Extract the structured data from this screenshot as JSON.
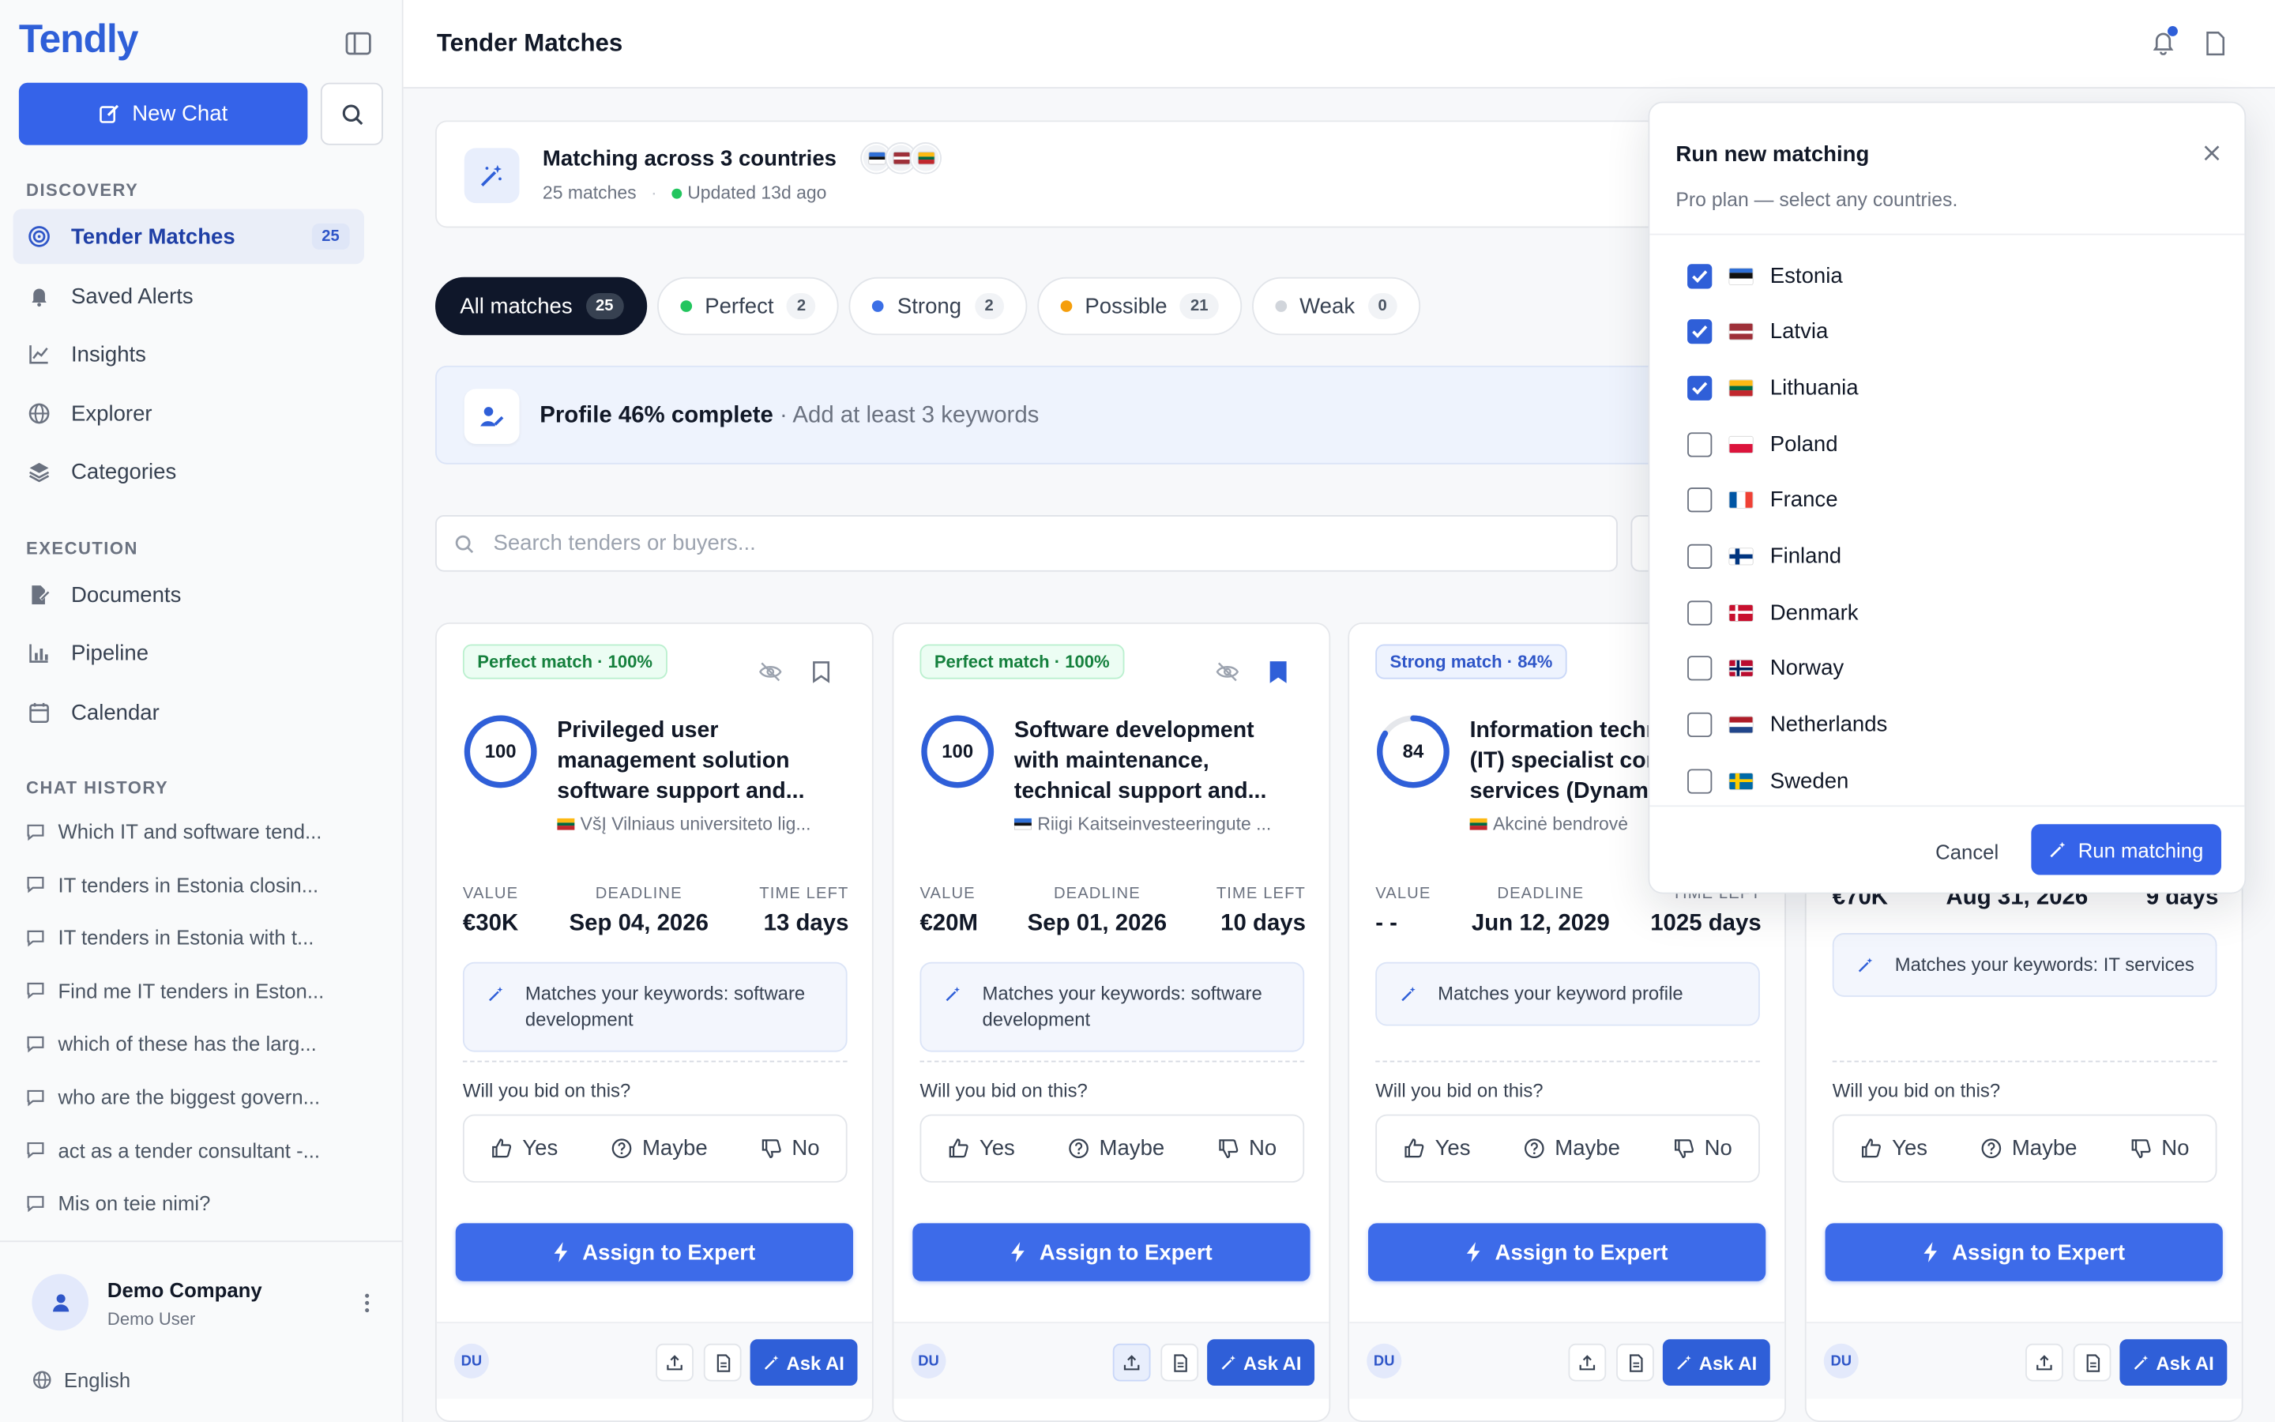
{
  "sidebar": {
    "logo": "Tendly",
    "new_chat": "New Chat",
    "discovery_title": "DISCOVERY",
    "discovery": [
      {
        "label": "Tender Matches",
        "badge": "25",
        "icon": "target-icon"
      },
      {
        "label": "Saved Alerts",
        "icon": "bell-icon"
      },
      {
        "label": "Insights",
        "icon": "chart-line-icon"
      },
      {
        "label": "Explorer",
        "icon": "globe-icon"
      },
      {
        "label": "Categories",
        "icon": "layers-icon"
      }
    ],
    "execution_title": "EXECUTION",
    "execution": [
      {
        "label": "Documents",
        "icon": "document-edit-icon"
      },
      {
        "label": "Pipeline",
        "icon": "bar-chart-icon"
      },
      {
        "label": "Calendar",
        "icon": "calendar-icon"
      }
    ],
    "history_title": "CHAT HISTORY",
    "history": [
      "Which IT and software tend...",
      "IT tenders in Estonia closin...",
      "IT tenders in Estonia with t...",
      "Find me IT tenders in Eston...",
      "which of these has the larg...",
      "who are the biggest govern...",
      "act as a tender consultant -...",
      "Mis on teie nimi?"
    ],
    "company": "Demo Company",
    "user": "Demo User",
    "language": "English"
  },
  "header": {
    "title": "Tender Matches"
  },
  "matching": {
    "title": "Matching across 3 countries",
    "count_text": "25 matches",
    "updated_text": "Updated 13d ago"
  },
  "filters": [
    {
      "label": "All matches",
      "count": "25",
      "color": ""
    },
    {
      "label": "Perfect",
      "count": "2",
      "color": "#22c55e"
    },
    {
      "label": "Strong",
      "count": "2",
      "color": "#3b6fe6"
    },
    {
      "label": "Possible",
      "count": "21",
      "color": "#f59e0b"
    },
    {
      "label": "Weak",
      "count": "0",
      "color": "#d1d5db"
    }
  ],
  "profile": {
    "bold": "Profile 46% complete",
    "rest": " · Add at least 3 keywords"
  },
  "search": {
    "placeholder": "Search tenders or buyers..."
  },
  "labels": {
    "value": "VALUE",
    "deadline": "DEADLINE",
    "time_left": "TIME LEFT",
    "bid_question": "Will you bid on this?",
    "yes": "Yes",
    "maybe": "Maybe",
    "no": "No",
    "assign": "Assign to Expert",
    "ask_ai": "Ask AI",
    "initials": "DU"
  },
  "cards": [
    {
      "tag": "Perfect match · 100%",
      "score": "100",
      "score_pct": 1.0,
      "title": "Privileged user management solution software support and...",
      "buyer": "VšĮ Vilniaus universiteto lig...",
      "value": "€30K",
      "deadline": "Sep 04, 2026",
      "time_left": "13 days",
      "keywords": "Matches your keywords: software development"
    },
    {
      "tag": "Perfect match · 100%",
      "score": "100",
      "score_pct": 1.0,
      "title": "Software development with maintenance, technical support and...",
      "buyer": "Riigi Kaitseinvesteeringute ...",
      "value": "€20M",
      "deadline": "Sep 01, 2026",
      "time_left": "10 days",
      "keywords": "Matches your keywords: software development"
    },
    {
      "tag": "Strong match · 84%",
      "score": "84",
      "score_pct": 0.84,
      "title": "Information technology (IT) specialist consulting services (Dynamics...",
      "buyer": "Akcinė bendrovė",
      "value": "- -",
      "deadline": "Jun 12, 2029",
      "time_left": "1025 days",
      "keywords": "Matches your keyword profile"
    },
    {
      "value": "€70K",
      "deadline": "Aug 31, 2026",
      "time_left": "9 days",
      "keywords": "Matches your keywords: IT services"
    }
  ],
  "panel": {
    "title": "Run new matching",
    "subtitle": "Pro plan — select any countries.",
    "countries": [
      {
        "name": "Estonia",
        "checked": true
      },
      {
        "name": "Latvia",
        "checked": true
      },
      {
        "name": "Lithuania",
        "checked": true
      },
      {
        "name": "Poland",
        "checked": false
      },
      {
        "name": "France",
        "checked": false
      },
      {
        "name": "Finland",
        "checked": false
      },
      {
        "name": "Denmark",
        "checked": false
      },
      {
        "name": "Norway",
        "checked": false
      },
      {
        "name": "Netherlands",
        "checked": false
      },
      {
        "name": "Sweden",
        "checked": false
      }
    ],
    "cancel": "Cancel",
    "run": "Run matching"
  }
}
